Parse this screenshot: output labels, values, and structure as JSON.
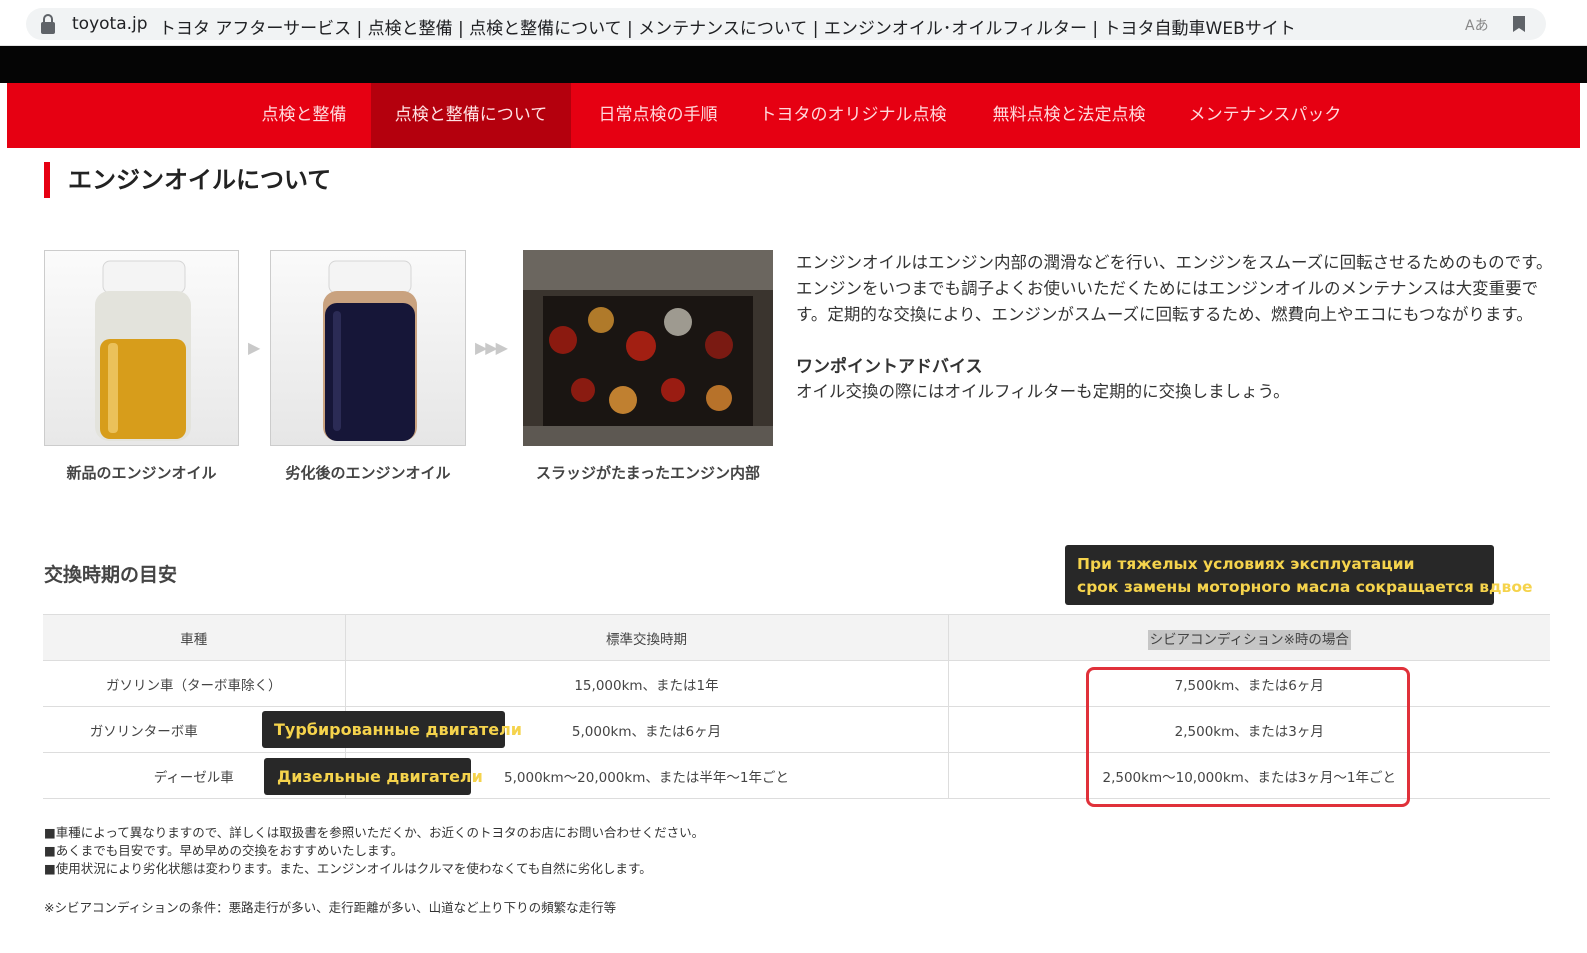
{
  "browser": {
    "host": "toyota.jp",
    "title": "トヨタ アフターサービス | 点検と整備 | 点検と整備について | メンテナンスについて | エンジンオイル･オイルフィルター | トヨタ自動車WEBサイト",
    "translate_glyph": "Aあ"
  },
  "nav": {
    "items": [
      {
        "label": "点検と整備"
      },
      {
        "label": "点検と整備について"
      },
      {
        "label": "日常点検の手順"
      },
      {
        "label": "トヨタのオリジナル点検"
      },
      {
        "label": "無料点検と法定点検"
      },
      {
        "label": "メンテナンスパック"
      }
    ],
    "active_index": 1
  },
  "heading": "エンジンオイルについて",
  "photos": [
    {
      "caption": "新品のエンジンオイル"
    },
    {
      "caption": "劣化後のエンジンオイル"
    },
    {
      "caption": "スラッジがたまったエンジン内部"
    }
  ],
  "intro": {
    "text": "エンジンオイルはエンジン内部の潤滑などを行い、エンジンをスムーズに回転させるためのものです。エンジンをいつまでも調子よくお使いいただくためにはエンジンオイルのメンテナンスは大変重要です。定期的な交換により、エンジンがスムーズに回転するため、燃費向上やエコにもつながります。",
    "advice_title": "ワンポイントアドバイス",
    "advice_text": "オイル交換の際にはオイルフィルターも定期的に交換しましょう。"
  },
  "schedule": {
    "title": "交換時期の目安",
    "headers": [
      "車種",
      "標準交換時期",
      "シビアコンディション※時の場合"
    ],
    "rows": [
      [
        "ガソリン車（ターボ車除く）",
        "15,000km、または1年",
        "7,500km、または6ヶ月"
      ],
      [
        "ガソリンターボ車",
        "5,000km、または6ヶ月",
        "2,500km、または3ヶ月"
      ],
      [
        "ディーゼル車",
        "5,000km〜20,000km、または半年〜1年ごと",
        "2,500km〜10,000km、または3ヶ月〜1年ごと"
      ]
    ]
  },
  "annotations": {
    "severe_line1": "При тяжелых условиях эксплуатации",
    "severe_line2": "срок замены моторного масла сокращается вдвое",
    "turbo": "Турбированные двигатели",
    "diesel": "Дизельные двигатели"
  },
  "footnotes": [
    "■車種によって異なりますので、詳しくは取扱書を参照いただくか、お近くのトヨタのお店にお問い合わせください。",
    "■あくまでも目安です。早め早めの交換をおすすめいたします。",
    "■使用状況により劣化状態は変わります。また、エンジンオイルはクルマを使わなくても自然に劣化します。"
  ],
  "severe_condition_note": "※シビアコンディションの条件：悪路走行が多い、走行距離が多い、山道など上り下りの頻繁な走行等",
  "colors": {
    "nav_red": "#e60012",
    "nav_active": "#b4000d",
    "annotation_bg": "#282828",
    "annotation_text": "#f5d34c",
    "highlight_box": "#e0313a"
  }
}
